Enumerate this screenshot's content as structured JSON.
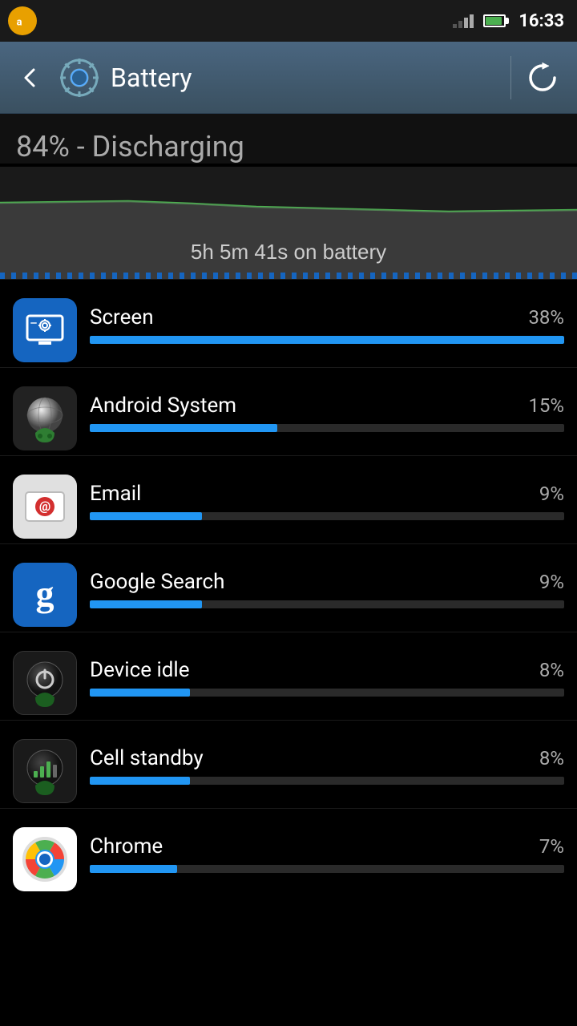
{
  "statusBar": {
    "time": "16:33",
    "batteryLevel": 85
  },
  "actionBar": {
    "backLabel": "‹",
    "title": "Battery",
    "refreshLabel": "↻"
  },
  "summary": {
    "percentText": "84% - Discharging",
    "onBatteryLabel": "5h 5m 41s on battery"
  },
  "items": [
    {
      "name": "Screen",
      "percent": "38%",
      "percentVal": 38,
      "iconType": "screen"
    },
    {
      "name": "Android System",
      "percent": "15%",
      "percentVal": 15,
      "iconType": "android"
    },
    {
      "name": "Email",
      "percent": "9%",
      "percentVal": 9,
      "iconType": "email"
    },
    {
      "name": "Google Search",
      "percent": "9%",
      "percentVal": 9,
      "iconType": "google"
    },
    {
      "name": "Device idle",
      "percent": "8%",
      "percentVal": 8,
      "iconType": "device-idle"
    },
    {
      "name": "Cell standby",
      "percent": "8%",
      "percentVal": 8,
      "iconType": "cell"
    },
    {
      "name": "Chrome",
      "percent": "7%",
      "percentVal": 7,
      "iconType": "chrome"
    }
  ]
}
